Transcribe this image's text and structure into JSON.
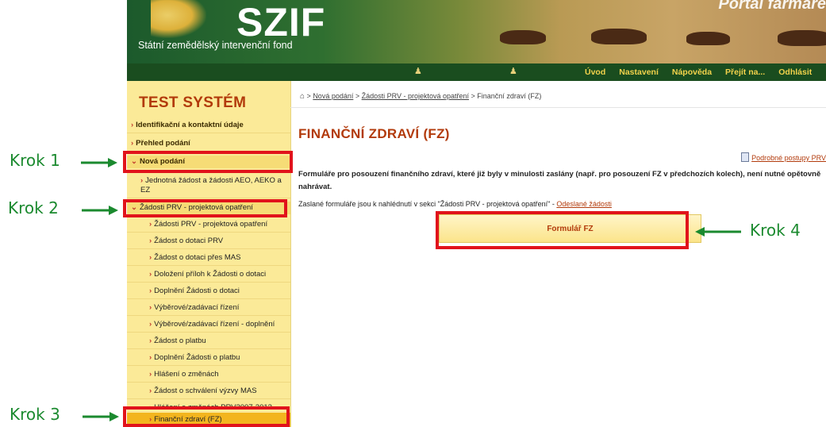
{
  "banner": {
    "logo": "SZIF",
    "subtitle": "Státní zemědělský intervenční fond",
    "portal_title": "Portál farmáře"
  },
  "navbar": {
    "links": [
      "Úvod",
      "Nastavení",
      "Nápověda",
      "Přejít na...",
      "Odhlásit"
    ]
  },
  "sidebar": {
    "system_title": "TEST SYSTÉM",
    "items": [
      {
        "label": "Identifikační a kontaktní údaje"
      },
      {
        "label": "Přehled podání"
      },
      {
        "label": "Nová podání"
      },
      {
        "label": "Jednotná žádost a žádosti AEO, AEKO a EZ"
      },
      {
        "label": "Žádosti PRV - projektová opatření"
      },
      {
        "label": "Žádosti PRV - projektová opatření"
      },
      {
        "label": "Žádost o dotaci PRV"
      },
      {
        "label": "Žádost o dotaci přes MAS"
      },
      {
        "label": "Doložení příloh k Žádosti o dotaci"
      },
      {
        "label": "Doplnění Žádosti o dotaci"
      },
      {
        "label": "Výběrové/zadávací řízení"
      },
      {
        "label": "Výběrové/zadávací řízení - doplnění"
      },
      {
        "label": "Žádost o platbu"
      },
      {
        "label": "Doplnění Žádosti o platbu"
      },
      {
        "label": "Hlášení o změnách"
      },
      {
        "label": "Žádost o schválení výzvy MAS"
      },
      {
        "label": "Hlášení o změnách PRV2007-2013"
      },
      {
        "label": "Finanční zdraví (FZ)"
      }
    ]
  },
  "breadcrumb": {
    "sep": " > ",
    "items": [
      "Nová podání",
      "Žádosti PRV - projektová opatření"
    ],
    "current": "Finanční zdraví (FZ)"
  },
  "main": {
    "title": "FINANČNÍ ZDRAVÍ (FZ)",
    "doc_link": "Podrobné postupy PRV",
    "info": "Formuláře pro posouzení finančního zdraví, které již byly v minulosti zaslány (např. pro posouzení FZ v předchozích kolech), není nutné opětovně nahrávat.",
    "sent_note": "Zaslané formuláře jsou k nahlédnutí v sekci \"Žádosti PRV - projektová opatření\" - ",
    "sent_link": "Odeslané žádosti",
    "form_button": "Formulář FZ"
  },
  "annotations": {
    "step1": "Krok 1",
    "step2": "Krok 2",
    "step3": "Krok 3",
    "step4": "Krok 4",
    "box_color": "#e1131b",
    "arrow_color": "#1b8a2f"
  }
}
